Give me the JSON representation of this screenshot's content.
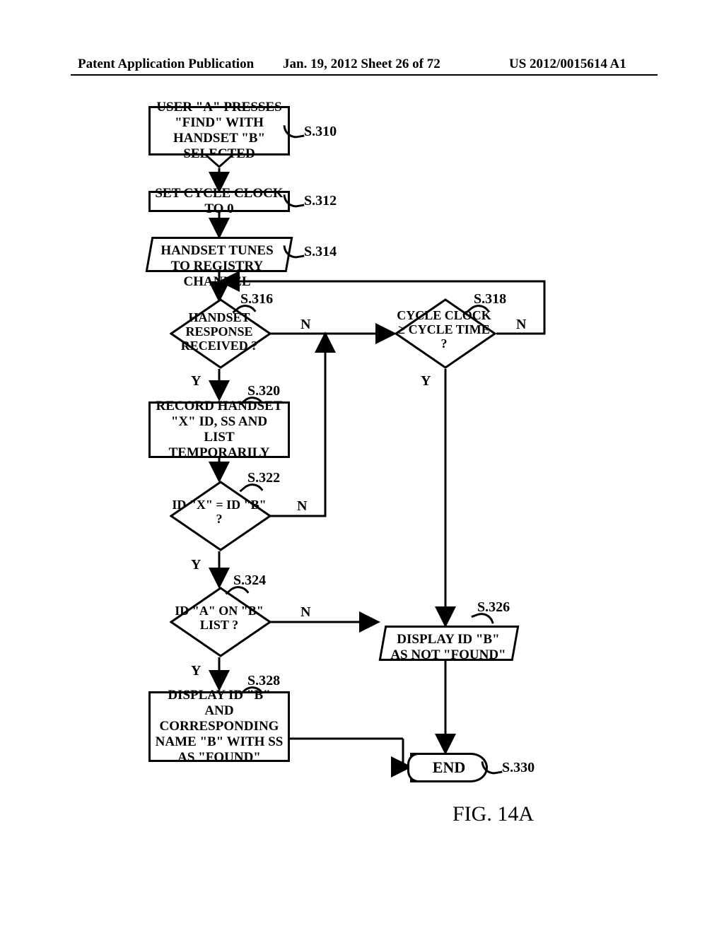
{
  "header": {
    "left": "Patent Application Publication",
    "mid": "Jan. 19, 2012  Sheet 26 of 72",
    "right": "US 2012/0015614 A1"
  },
  "nodes": {
    "s310": "USER \"A\" PRESSES \"FIND\" WITH HANDSET \"B\" SELECTED",
    "s312": "SET CYCLE CLOCK TO 0",
    "s314": "HANDSET TUNES TO REGISTRY CHANNEL",
    "s316": "HANDSET RESPONSE RECEIVED ?",
    "s318": "CYCLE CLOCK ≥ CYCLE TIME ?",
    "s320": "RECORD HANDSET \"X\" ID, SS AND LIST TEMPORARILY",
    "s322": "ID \"X\" = ID \"B\" ?",
    "s324": "ID \"A\" ON \"B\" LIST ?",
    "s326": "DISPLAY ID \"B\" AS NOT \"FOUND\"",
    "s328": "DISPLAY ID \"B\" AND CORRESPONDING NAME \"B\" WITH SS AS \"FOUND\"",
    "s330": "END"
  },
  "refs": {
    "s310": "S.310",
    "s312": "S.312",
    "s314": "S.314",
    "s316": "S.316",
    "s318": "S.318",
    "s320": "S.320",
    "s322": "S.322",
    "s324": "S.324",
    "s326": "S.326",
    "s328": "S.328",
    "s330": "S.330"
  },
  "edgelabels": {
    "y": "Y",
    "n": "N"
  },
  "figure": "FIG. 14A"
}
